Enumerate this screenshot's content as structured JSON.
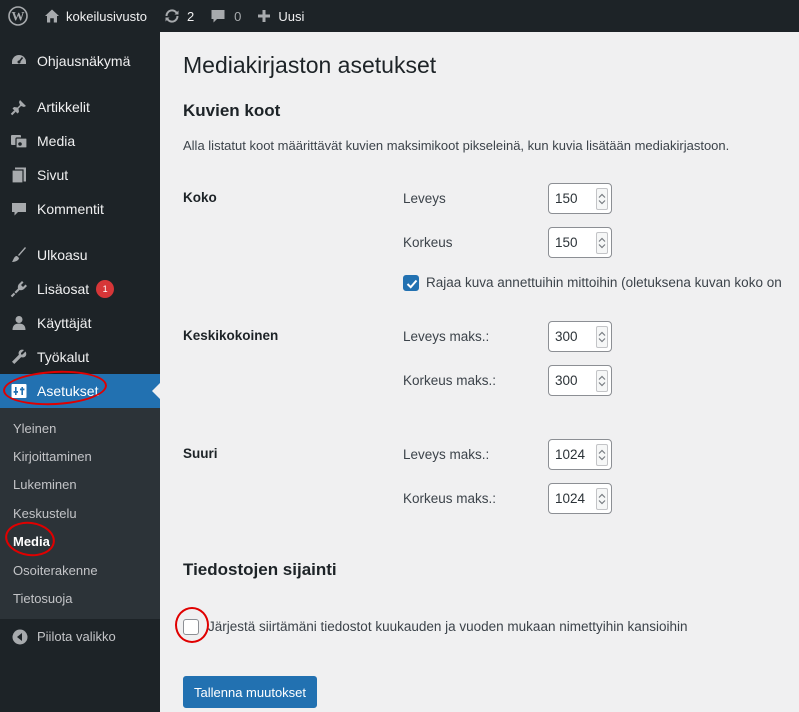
{
  "admin_bar": {
    "site_name": "kokeilusivusto",
    "updates_count": "2",
    "comments_count": "0",
    "new_label": "Uusi"
  },
  "sidebar": {
    "items": [
      {
        "label": "Ohjausnäkymä",
        "icon": "dashboard-icon"
      },
      {
        "label": "Artikkelit",
        "icon": "pin-icon"
      },
      {
        "label": "Media",
        "icon": "media-icon"
      },
      {
        "label": "Sivut",
        "icon": "pages-icon"
      },
      {
        "label": "Kommentit",
        "icon": "comment-icon"
      },
      {
        "label": "Ulkoasu",
        "icon": "brush-icon"
      },
      {
        "label": "Lisäosat",
        "icon": "plugin-icon",
        "badge": "1"
      },
      {
        "label": "Käyttäjät",
        "icon": "users-icon"
      },
      {
        "label": "Työkalut",
        "icon": "wrench-icon"
      },
      {
        "label": "Asetukset",
        "icon": "settings-icon"
      }
    ],
    "submenu": [
      "Yleinen",
      "Kirjoittaminen",
      "Lukeminen",
      "Keskustelu",
      "Media",
      "Osoiterakenne",
      "Tietosuoja"
    ],
    "collapse_label": "Piilota valikko"
  },
  "main": {
    "title": "Mediakirjaston asetukset",
    "section_sizes": "Kuvien koot",
    "description": "Alla listatut koot määrittävät kuvien maksimikoot pikseleinä, kun kuvia lisätään mediakirjastoon.",
    "thumbnail": {
      "heading": "Koko",
      "width_label": "Leveys",
      "width_value": "150",
      "height_label": "Korkeus",
      "height_value": "150",
      "crop_label": "Rajaa kuva annettuihin mittoihin (oletuksena kuvan koko on"
    },
    "medium": {
      "heading": "Keskikokoinen",
      "width_label": "Leveys maks.:",
      "width_value": "300",
      "height_label": "Korkeus maks.:",
      "height_value": "300"
    },
    "large": {
      "heading": "Suuri",
      "width_label": "Leveys maks.:",
      "width_value": "1024",
      "height_label": "Korkeus maks.:",
      "height_value": "1024"
    },
    "section_uploads": "Tiedostojen sijainti",
    "uploads_label": "Järjestä siirtämäni tiedostot kuukauden ja vuoden mukaan nimettyihin kansioihin",
    "save_label": "Tallenna muutokset"
  },
  "colors": {
    "accent": "#2271b1",
    "sidebar_bg": "#1d2327",
    "annotation": "#e00000"
  }
}
